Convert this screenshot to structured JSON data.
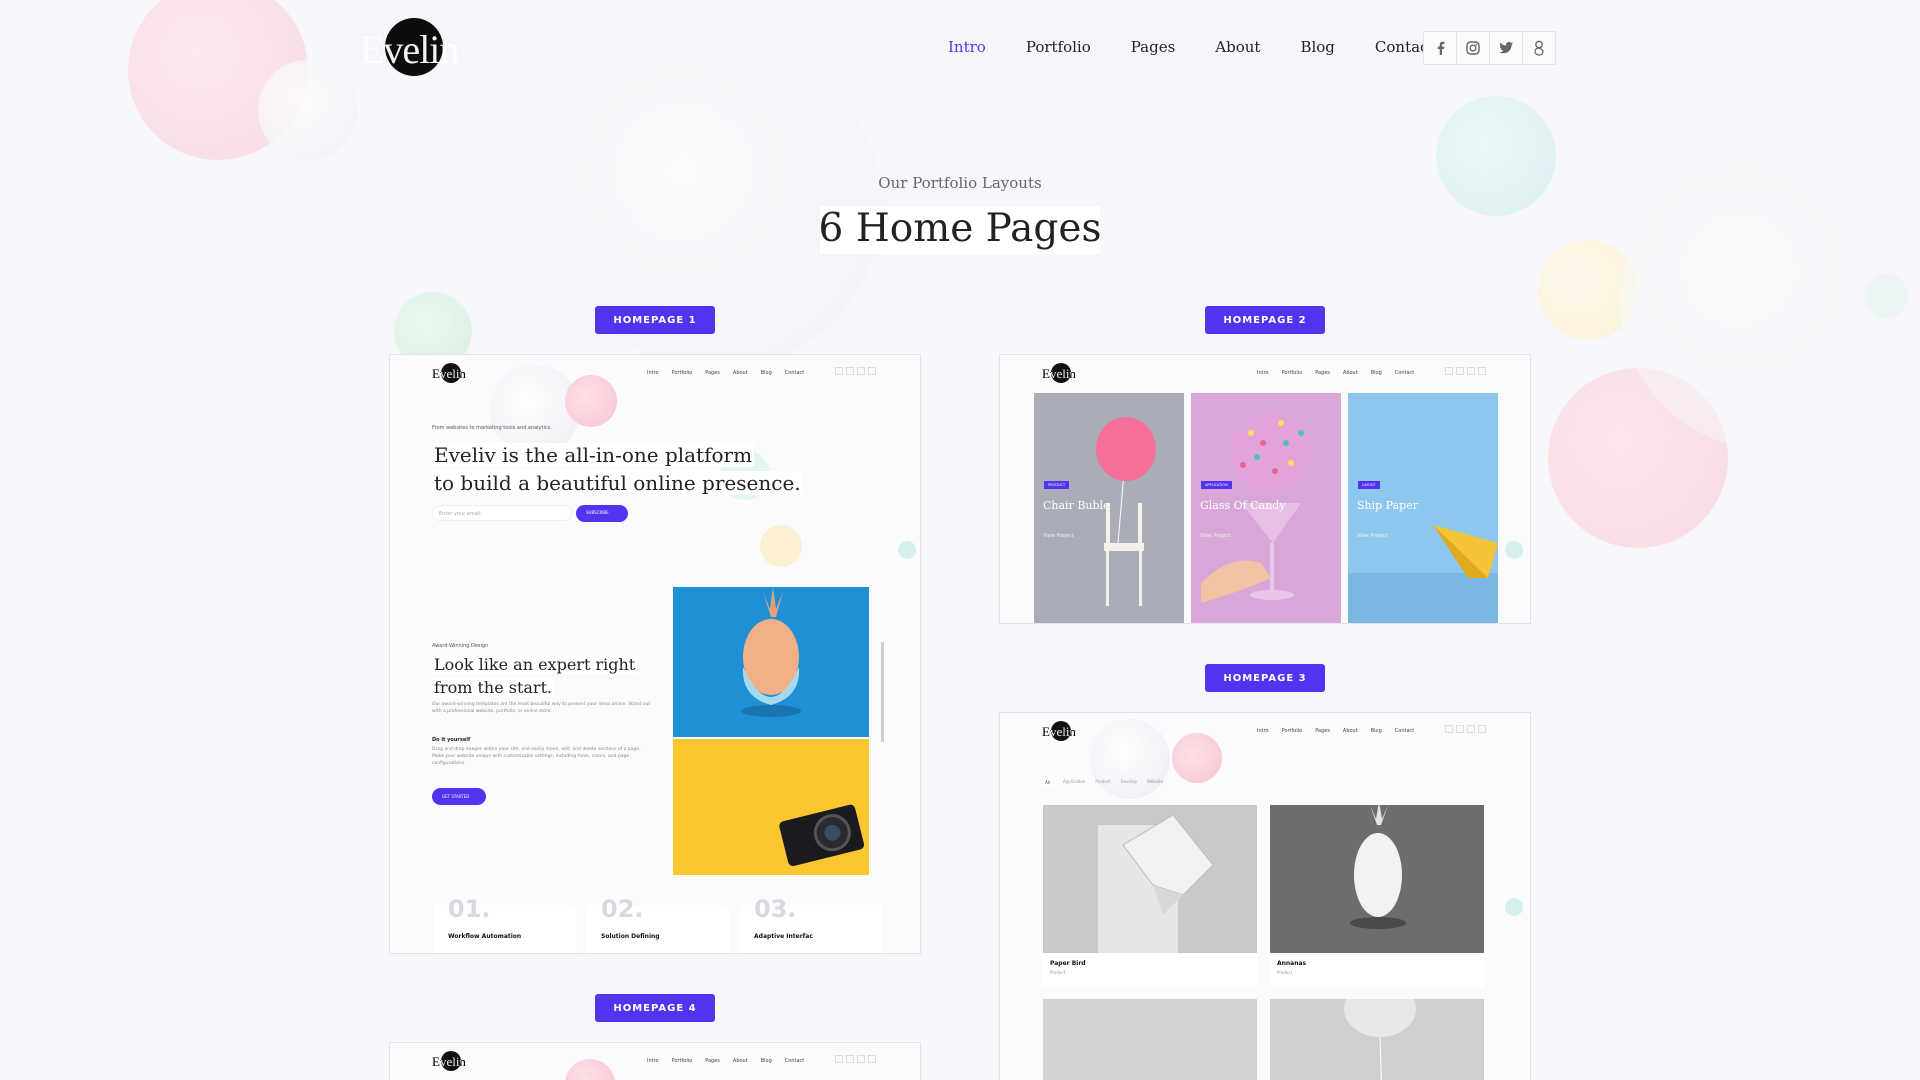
{
  "header": {
    "logo": "Evelin",
    "nav": [
      {
        "label": "Intro",
        "active": true
      },
      {
        "label": "Portfolio"
      },
      {
        "label": "Pages"
      },
      {
        "label": "About"
      },
      {
        "label": "Blog"
      },
      {
        "label": "Contact"
      }
    ],
    "social": [
      "facebook-icon",
      "instagram-icon",
      "twitter-icon",
      "google-plus-icon"
    ]
  },
  "section": {
    "subtitle": "Our Portfolio Layouts",
    "title": "6 Home Pages"
  },
  "homepages": [
    {
      "label": "HOMEPAGE 1"
    },
    {
      "label": "HOMEPAGE 2"
    },
    {
      "label": "HOMEPAGE 3"
    },
    {
      "label": "HOMEPAGE 4"
    }
  ],
  "mini": {
    "logo": "Evelin",
    "logo_alt": "Eveliv",
    "nav": [
      "Intro",
      "Portfolio",
      "Pages",
      "About",
      "Blog",
      "Contact"
    ]
  },
  "hp1": {
    "kicker": "From websites to marketing tools and analytics.",
    "headline_1": "Eveliv is the all-in-one platform",
    "headline_2": "to build a beautiful online presence.",
    "email_placeholder": "Enter your email",
    "subscribe": "SUBSCRIBE",
    "award": "Award-Winning Design",
    "expert_1": "Look like an expert right",
    "expert_2": "from the start.",
    "expert_body": "Our award-winning templates are the most beautiful way to present your ideas online. Stand out with a professional website, portfolio, or online store.",
    "diy_title": "Do it yourself",
    "diy_body": "Drag and drop images within your site, and easily move, add, and delete sections of a page. Make your website unique with customizable settings, including fonts, colors, and page configurations.",
    "cta": "GET STARTED",
    "features": [
      {
        "num": "01.",
        "label": "Workflow Automation"
      },
      {
        "num": "02.",
        "label": "Solution Defining"
      },
      {
        "num": "03.",
        "label": "Adaptive Interfac"
      }
    ]
  },
  "hp2": {
    "cards": [
      {
        "tag": "PRODUCT",
        "title": "Chair Buble",
        "link": "View Project"
      },
      {
        "tag": "APPLICATION",
        "title": "Glass Of Candy",
        "link": "View Project"
      },
      {
        "tag": "LAYOUT",
        "title": "Ship Paper",
        "link": "View Project"
      }
    ]
  },
  "hp3": {
    "filters": [
      "All",
      "Application",
      "Product",
      "Develop",
      "Website"
    ],
    "items": [
      {
        "title": "Paper Bird",
        "cat": "Product"
      },
      {
        "title": "Annanas",
        "cat": "Product"
      }
    ]
  }
}
